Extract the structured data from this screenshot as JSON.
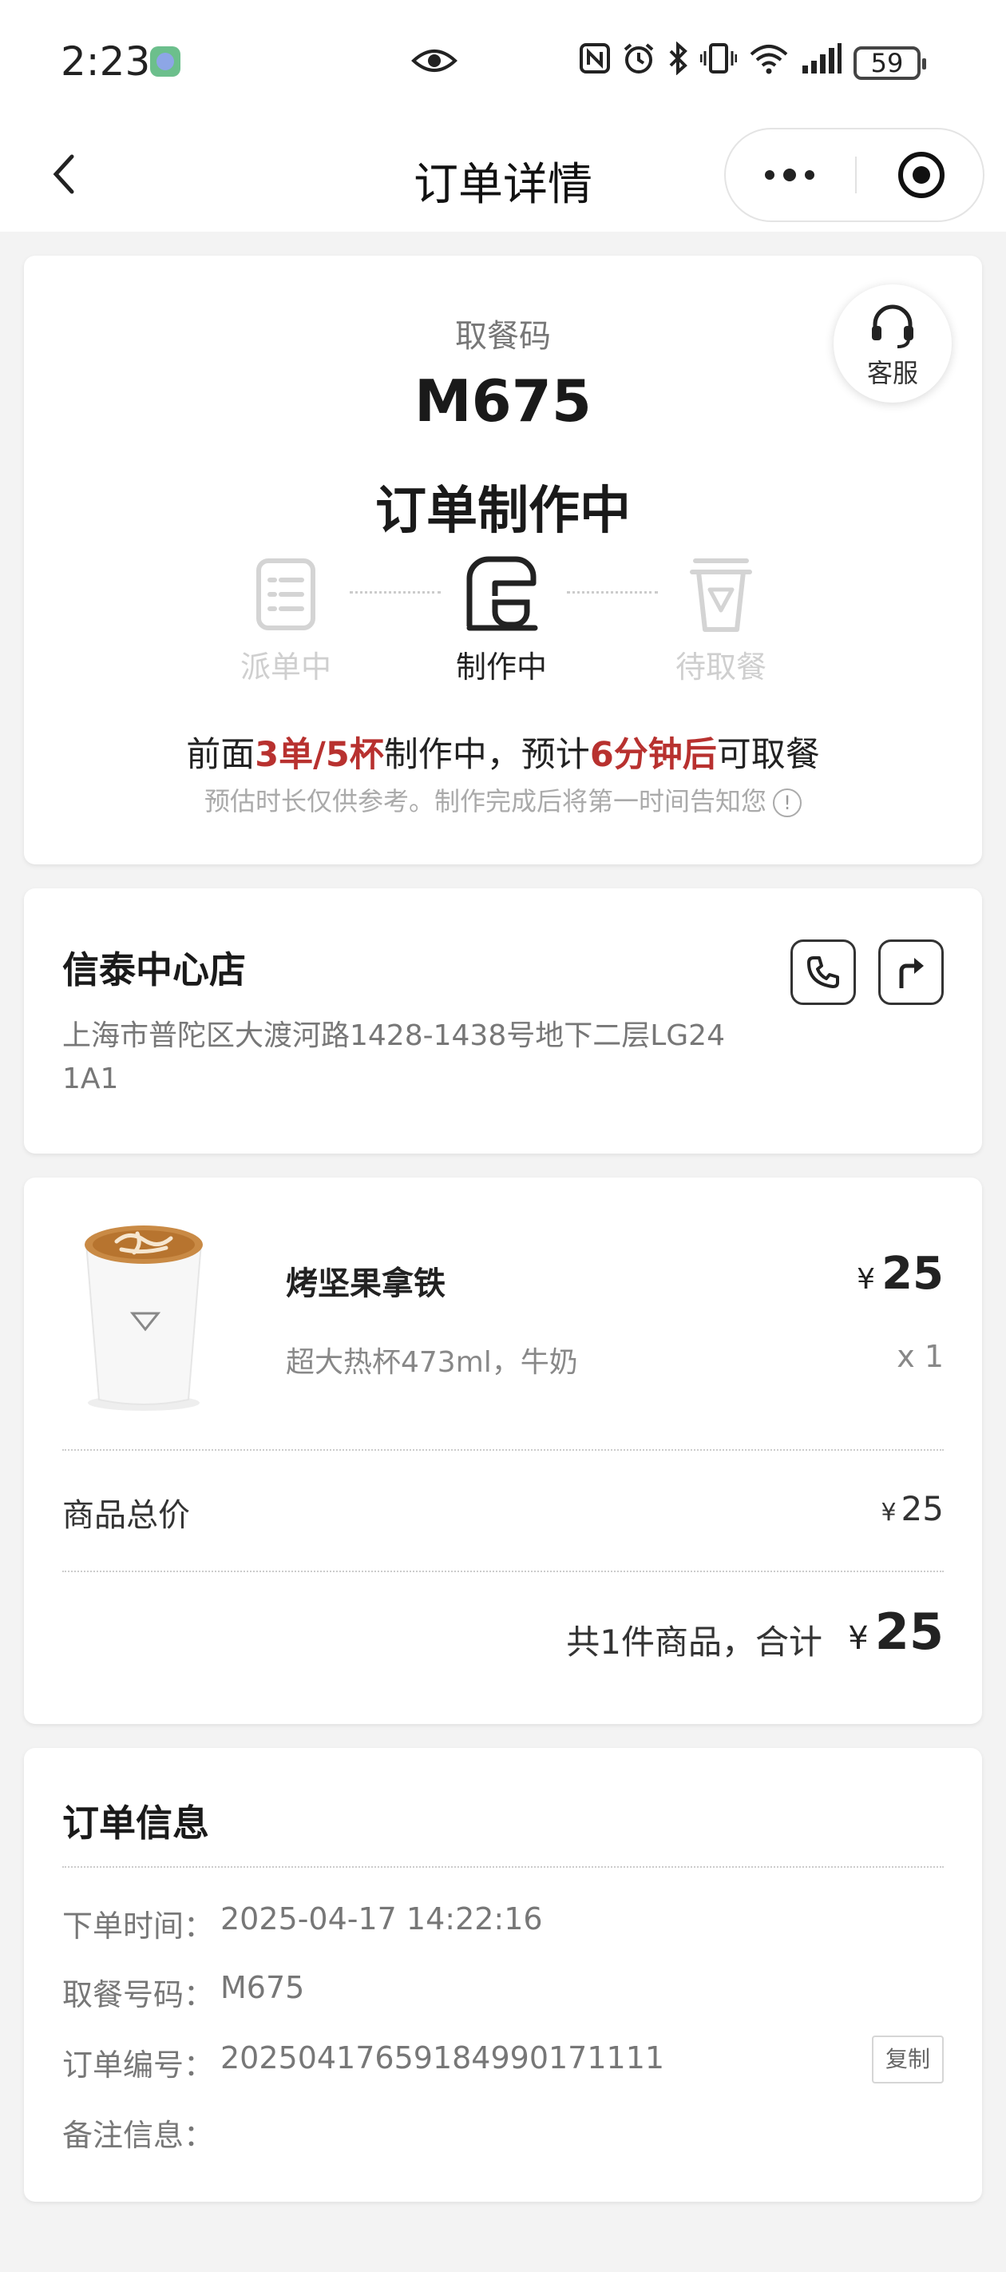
{
  "status_bar": {
    "time": "2:23",
    "battery": "59",
    "icons": [
      "eye-icon",
      "nfc-icon",
      "alarm-icon",
      "bluetooth-icon",
      "vibrate-icon",
      "wifi-icon",
      "signal-icon",
      "battery-icon"
    ]
  },
  "nav": {
    "title": "订单详情"
  },
  "order": {
    "pickup_label": "取餐码",
    "pickup_code": "M675",
    "status_title": "订单制作中",
    "service_label": "客服",
    "steps": [
      {
        "label": "派单中",
        "state": "done"
      },
      {
        "label": "制作中",
        "state": "active"
      },
      {
        "label": "待取餐",
        "state": "pending"
      }
    ],
    "eta": {
      "prefix": "前面",
      "queue": "3单/5杯",
      "middle": "制作中，预计",
      "time": "6分钟后",
      "suffix": "可取餐"
    },
    "eta_note": "预估时长仅供参考。制作完成后将第一时间告知您",
    "info_icon": "!"
  },
  "store": {
    "name": "信泰中心店",
    "address": "上海市普陀区大渡河路1428-1438号地下二层LG24 1A1"
  },
  "product": {
    "name": "烤坚果拿铁",
    "spec": "超大热杯473ml，牛奶",
    "currency": "¥",
    "price": "25",
    "qty": "x 1"
  },
  "summary": {
    "subtotal_label": "商品总价",
    "subtotal_value": "25",
    "total_text": "共1件商品，合计",
    "total_value": "25"
  },
  "info": {
    "title": "订单信息",
    "rows": [
      {
        "label": "下单时间：",
        "value": "2025-04-17 14:22:16"
      },
      {
        "label": "取餐号码：",
        "value": "M675"
      },
      {
        "label": "订单编号：",
        "value": "20250417659184990171111"
      },
      {
        "label": "备注信息：",
        "value": ""
      }
    ],
    "copy_label": "复制"
  },
  "colors": {
    "accent_red": "#b8312f",
    "background": "#f3f3f3",
    "card": "#ffffff"
  }
}
